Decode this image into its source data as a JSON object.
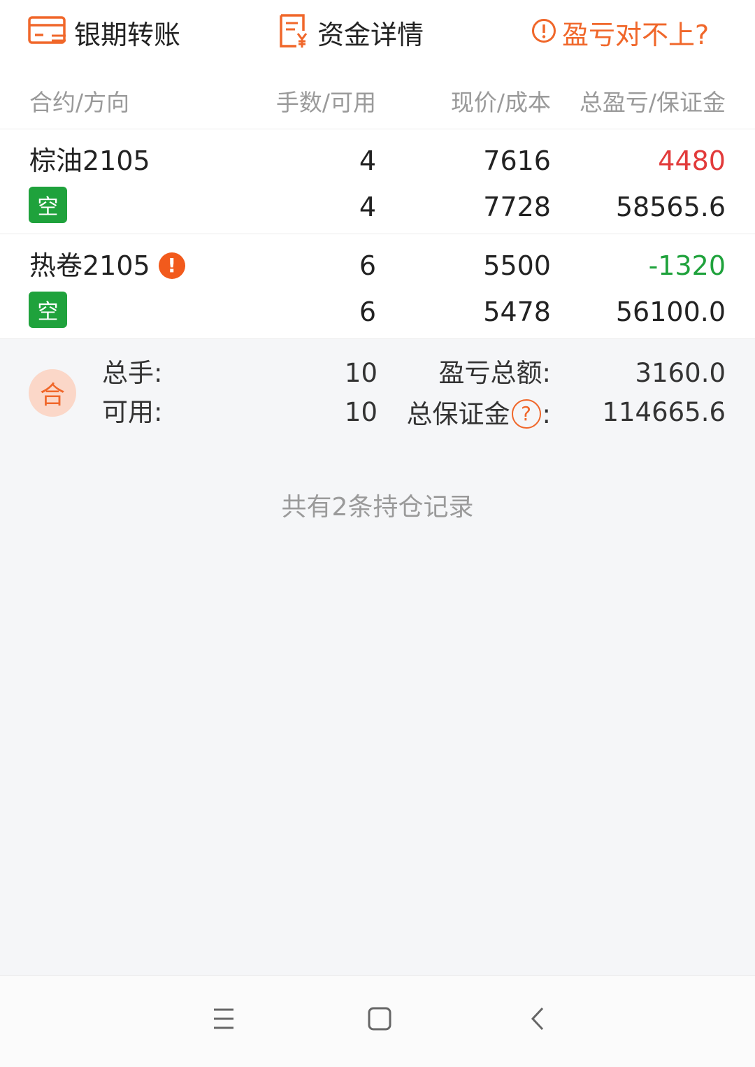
{
  "actions": {
    "transfer_label": "银期转账",
    "funds_label": "资金详情",
    "mismatch_label": "盈亏对不上?"
  },
  "headers": {
    "contract": "合约/方向",
    "lots": "手数/可用",
    "price": "现价/成本",
    "pnl": "总盈亏/保证金"
  },
  "positions": [
    {
      "name": "棕油2105",
      "direction": "空",
      "lots": "4",
      "available": "4",
      "price": "7616",
      "cost": "7728",
      "pnl": "4480",
      "margin": "58565.6",
      "pnl_color": "#e23b3b"
    },
    {
      "name": "热卷2105",
      "warn": "!",
      "direction": "空",
      "lots": "6",
      "available": "6",
      "price": "5500",
      "cost": "5478",
      "pnl": "-1320",
      "margin": "56100.0",
      "pnl_color": "#1fa23c"
    }
  ],
  "summary": {
    "badge": "合",
    "total_lots_label": "总手:",
    "total_lots": "10",
    "available_label": "可用:",
    "available": "10",
    "pnl_label": "盈亏总额:",
    "pnl": "3160.0",
    "margin_label": "总保证金",
    "margin_help": "?",
    "margin_colon": ":",
    "margin": "114665.6"
  },
  "footer": {
    "record_text": "共有2条持仓记录"
  },
  "icons": {
    "transfer": "card-transfer-icon",
    "funds": "document-yen-icon",
    "mismatch": "alert-circle-icon",
    "menu": "menu-icon",
    "home": "home-square-icon",
    "back": "back-chevron-icon"
  },
  "colors": {
    "accent": "#f0672a",
    "profit": "#e23b3b",
    "loss": "#1fa23c",
    "short_badge": "#1fa23c"
  }
}
